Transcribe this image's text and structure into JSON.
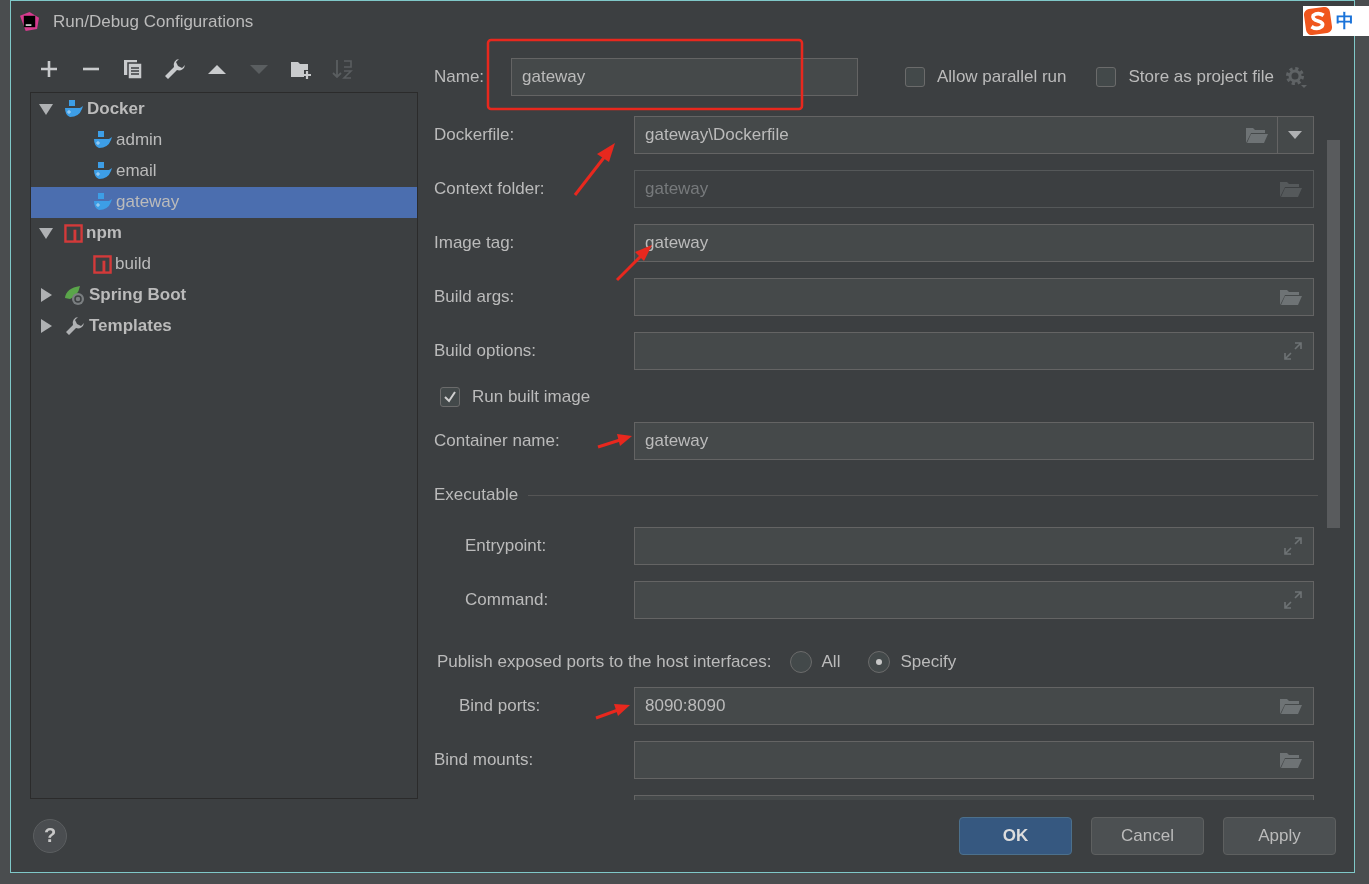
{
  "window": {
    "title": "Run/Debug Configurations"
  },
  "ime_indicator": {
    "label": "中"
  },
  "toolbar": [
    {
      "kind": "add",
      "disabled": false
    },
    {
      "kind": "remove",
      "disabled": false
    },
    {
      "kind": "copy",
      "disabled": false
    },
    {
      "kind": "edit",
      "disabled": false
    },
    {
      "kind": "move_up",
      "disabled": false
    },
    {
      "kind": "move_down",
      "disabled": true
    },
    {
      "kind": "new_folder",
      "disabled": false
    },
    {
      "kind": "sort",
      "disabled": true
    }
  ],
  "tree": [
    {
      "label": "Docker",
      "kind": "docker",
      "expanded": true,
      "selected": false,
      "children": [
        {
          "label": "admin",
          "kind": "docker",
          "selected": false
        },
        {
          "label": "email",
          "kind": "docker",
          "selected": false
        },
        {
          "label": "gateway",
          "kind": "docker",
          "selected": true
        }
      ]
    },
    {
      "label": "npm",
      "kind": "npm",
      "expanded": true,
      "selected": false,
      "children": [
        {
          "label": "build",
          "kind": "npm",
          "selected": false
        }
      ]
    },
    {
      "label": "Spring Boot",
      "kind": "spring",
      "expanded": false,
      "selected": false
    },
    {
      "label": "Templates",
      "kind": "templates",
      "expanded": false,
      "selected": false
    }
  ],
  "name_field": {
    "label": "Name:",
    "value": "gateway"
  },
  "options": [
    {
      "label": "Allow parallel run",
      "checked": false
    },
    {
      "label": "Store as project file",
      "checked": false
    }
  ],
  "form": [
    {
      "kind": "combo",
      "label": "Dockerfile:",
      "value": "gateway\\Dockerfile",
      "disabled": false
    },
    {
      "kind": "browse",
      "label": "Context folder:",
      "value": "gateway",
      "disabled": true
    },
    {
      "kind": "text",
      "label": "Image tag:",
      "value": "gateway",
      "disabled": false
    },
    {
      "kind": "browse",
      "label": "Build args:",
      "disabled": false
    },
    {
      "kind": "expand",
      "label": "Build options:",
      "disabled": false
    },
    {
      "kind": "checkbox",
      "label": "Run built image",
      "checked": true
    },
    {
      "kind": "text",
      "label": "Container name:",
      "value": "gateway",
      "disabled": false
    },
    {
      "kind": "section",
      "label": "Executable",
      "children": [
        {
          "kind": "expand",
          "label": "Entrypoint:",
          "disabled": false
        },
        {
          "kind": "expand",
          "label": "Command:",
          "disabled": false
        }
      ]
    },
    {
      "kind": "radio_group",
      "label": "Publish exposed ports to the host interfaces:",
      "options": [
        {
          "label": "All",
          "selected": false
        },
        {
          "label": "Specify",
          "selected": true
        }
      ],
      "children": [
        {
          "kind": "browse",
          "label": "Bind ports:",
          "value": "8090:8090",
          "disabled": false
        }
      ]
    },
    {
      "kind": "browse",
      "label": "Bind mounts:",
      "disabled": false
    }
  ],
  "help": "?",
  "buttons": [
    {
      "label": "OK",
      "kind": "primary"
    },
    {
      "label": "Cancel",
      "kind": "normal"
    },
    {
      "label": "Apply",
      "kind": "normal"
    }
  ]
}
